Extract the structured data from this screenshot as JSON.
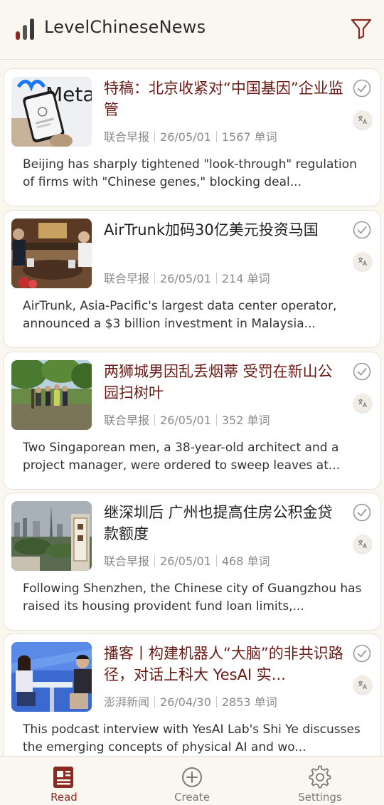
{
  "app": {
    "title": "LevelChineseNews"
  },
  "colors": {
    "accent": "#8b2a20",
    "title_red": "#6a1a14",
    "background": "#faf7f0"
  },
  "articles": [
    {
      "title": "特稿：北京收紧对“中国基因”企业监管",
      "source": "联合早报",
      "date": "26/05/01",
      "words": "1567 单词",
      "summary": "Beijing has sharply tightened \"look-through\" regulation of firms with \"Chinese genes,\" blocking deal...",
      "title_style": "red",
      "thumb_icon": "meta-phone-photo"
    },
    {
      "title": "AirTrunk加码30亿美元投资马国",
      "source": "联合早报",
      "date": "26/05/01",
      "words": "214 单词",
      "summary": "AirTrunk, Asia-Pacific's largest data center operator, announced a $3 billion investment in Malaysia...",
      "title_style": "dark",
      "thumb_icon": "meeting-photo"
    },
    {
      "title": "两狮城男因乱丢烟蒂 受罚在新山公园扫树叶",
      "source": "联合早报",
      "date": "26/05/01",
      "words": "352 单词",
      "summary": "Two Singaporean men, a 38-year-old architect and a project manager, were ordered to sweep leaves at...",
      "title_style": "red",
      "thumb_icon": "park-photo"
    },
    {
      "title": "继深圳后 广州也提高住房公积金贷款额度",
      "source": "联合早报",
      "date": "26/05/01",
      "words": "468 单词",
      "summary": "Following Shenzhen, the Chinese city of Guangzhou has raised its housing provident fund loan limits,...",
      "title_style": "dark",
      "thumb_icon": "city-photo"
    },
    {
      "title": "播客丨构建机器人“大脑”的非共识路径，对话上科大 YesAI 实...",
      "source": "澎湃新闻",
      "date": "26/04/30",
      "words": "2853 单词",
      "summary": "This podcast interview with YesAI Lab's Shi Ye discusses the emerging concepts of physical AI and wo...",
      "title_style": "red",
      "thumb_icon": "studio-photo"
    }
  ],
  "nav": {
    "read": "Read",
    "create": "Create",
    "settings": "Settings",
    "active": "read"
  }
}
